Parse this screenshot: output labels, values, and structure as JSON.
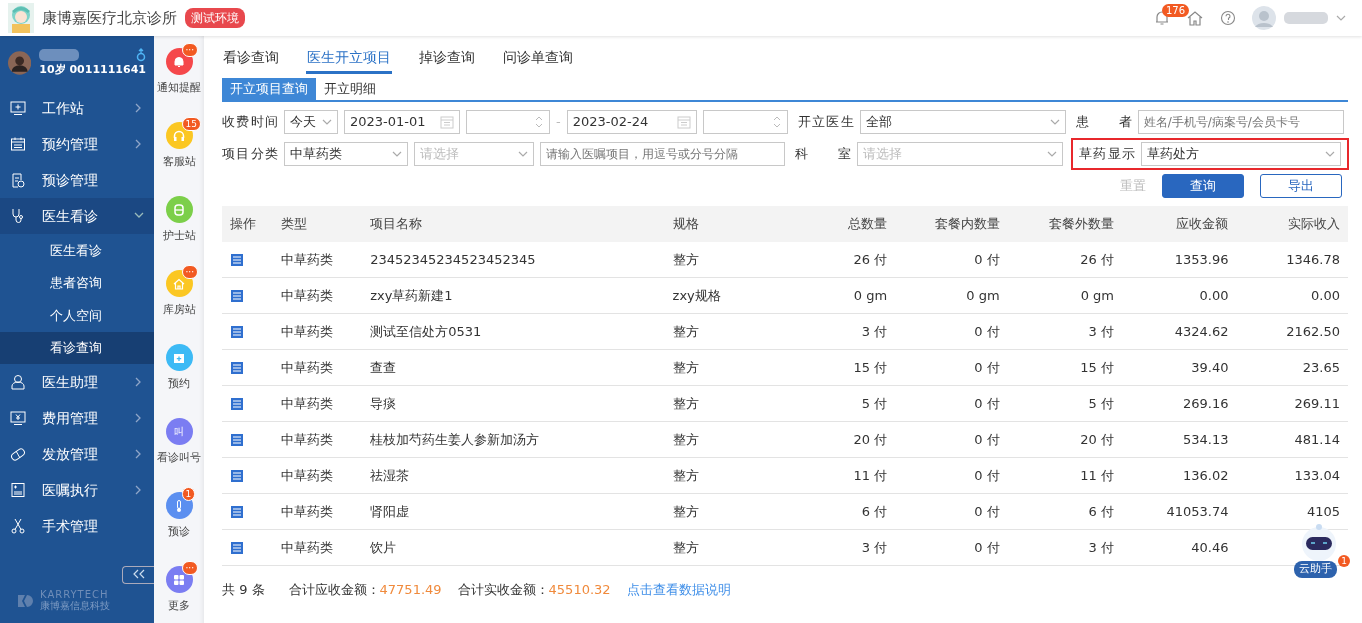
{
  "header": {
    "clinic_name": "康博嘉医疗北京诊所",
    "env_badge": "测试环境",
    "notification_count": "176"
  },
  "user": {
    "info": "10岁 0011111641"
  },
  "menu": [
    {
      "label": "工作站",
      "expandable": true,
      "expanded": false
    },
    {
      "label": "预约管理",
      "expandable": true,
      "expanded": false
    },
    {
      "label": "预诊管理",
      "expandable": false,
      "expanded": false
    },
    {
      "label": "医生看诊",
      "expandable": true,
      "expanded": true,
      "children": [
        {
          "label": "医生看诊",
          "selected": false
        },
        {
          "label": "患者咨询",
          "selected": false
        },
        {
          "label": "个人空间",
          "selected": false
        },
        {
          "label": "看诊查询",
          "selected": true
        }
      ]
    },
    {
      "label": "医生助理",
      "expandable": true,
      "expanded": false
    },
    {
      "label": "费用管理",
      "expandable": true,
      "expanded": false
    },
    {
      "label": "发放管理",
      "expandable": true,
      "expanded": false
    },
    {
      "label": "医嘱执行",
      "expandable": true,
      "expanded": false
    },
    {
      "label": "手术管理",
      "expandable": false,
      "expanded": false
    }
  ],
  "brand": "KARRYTECH",
  "brand_sub": "康博嘉信息科技",
  "quick_links": [
    {
      "label": "通知提醒",
      "color": "#f5484b",
      "badge": "···"
    },
    {
      "label": "客服站",
      "color": "#fbc723",
      "badge": "15"
    },
    {
      "label": "护士站",
      "color": "#7ccf4a"
    },
    {
      "label": "库房站",
      "color": "#fbc723",
      "badge": "···"
    },
    {
      "label": "预约",
      "color": "#3dbaf5"
    },
    {
      "label": "看诊叫号",
      "color": "#7b7df2",
      "glyph": "叫"
    },
    {
      "label": "预诊",
      "color": "#5b8ff0",
      "badge": "1"
    },
    {
      "label": "更多",
      "color": "#7b7df2",
      "badge": "···"
    }
  ],
  "tabs": [
    {
      "label": "看诊查询",
      "selected": false
    },
    {
      "label": "医生开立项目",
      "selected": true
    },
    {
      "label": "掉诊查询",
      "selected": false
    },
    {
      "label": "问诊单查询",
      "selected": false
    }
  ],
  "subtabs": [
    {
      "label": "开立项目查询",
      "selected": true
    },
    {
      "label": "开立明细",
      "selected": false
    }
  ],
  "filters": {
    "charge_time": {
      "label": "收费时间",
      "range": "今天",
      "start_date": "2023-01-01",
      "separator": "-",
      "end_date": "2023-02-24"
    },
    "doctor": {
      "label": "开立医生",
      "value": "全部"
    },
    "patient": {
      "label": "患者",
      "placeholder": "姓名/手机号/病案号/会员卡号"
    },
    "category": {
      "label": "项目分类",
      "value": "中草药类",
      "sub_placeholder": "请选择",
      "items_placeholder": "请输入医嘱项目，用逗号或分号分隔"
    },
    "department": {
      "label": "科室",
      "placeholder": "请选择"
    },
    "herb_display": {
      "label": "草药显示",
      "value": "草药处方",
      "highlighted": true
    }
  },
  "buttons": [
    {
      "label": "重置",
      "kind": "disabled"
    },
    {
      "label": "查询",
      "kind": "primary"
    },
    {
      "label": "导出",
      "kind": "outline"
    }
  ],
  "table": {
    "columns": [
      "操作",
      "类型",
      "项目名称",
      "规格",
      "总数量",
      "套餐内数量",
      "套餐外数量",
      "应收金额",
      "实际收入"
    ],
    "rows": [
      {
        "type": "中草药类",
        "name": "23452345234523452345",
        "spec": "整方",
        "total": "26 付",
        "in_package": "0 付",
        "out_package": "26 付",
        "receivable": "1353.96",
        "received": "1346.78"
      },
      {
        "type": "中草药类",
        "name": "zxy草药新建1",
        "spec": "zxy规格",
        "total": "0 gm",
        "in_package": "0 gm",
        "out_package": "0 gm",
        "receivable": "0.00",
        "received": "0.00"
      },
      {
        "type": "中草药类",
        "name": "测试至信处方0531",
        "spec": "整方",
        "total": "3 付",
        "in_package": "0 付",
        "out_package": "3 付",
        "receivable": "4324.62",
        "received": "2162.50"
      },
      {
        "type": "中草药类",
        "name": "查查",
        "spec": "整方",
        "total": "15 付",
        "in_package": "0 付",
        "out_package": "15 付",
        "receivable": "39.40",
        "received": "23.65"
      },
      {
        "type": "中草药类",
        "name": "导痰",
        "spec": "整方",
        "total": "5 付",
        "in_package": "0 付",
        "out_package": "5 付",
        "receivable": "269.16",
        "received": "269.11"
      },
      {
        "type": "中草药类",
        "name": "桂枝加芍药生姜人参新加汤方",
        "spec": "整方",
        "total": "20 付",
        "in_package": "0 付",
        "out_package": "20 付",
        "receivable": "534.13",
        "received": "481.14"
      },
      {
        "type": "中草药类",
        "name": "祛湿茶",
        "spec": "整方",
        "total": "11 付",
        "in_package": "0 付",
        "out_package": "11 付",
        "receivable": "136.02",
        "received": "133.04"
      },
      {
        "type": "中草药类",
        "name": "肾阳虚",
        "spec": "整方",
        "total": "6 付",
        "in_package": "0 付",
        "out_package": "6 付",
        "receivable": "41053.74",
        "received": "4105"
      },
      {
        "type": "中草药类",
        "name": "饮片",
        "spec": "整方",
        "total": "3 付",
        "in_package": "0 付",
        "out_package": "3 付",
        "receivable": "40.46"
      }
    ]
  },
  "footer": {
    "count": "共 9 条",
    "receivable_label": "合计应收金额：",
    "receivable_total": "47751.49",
    "received_label": "合计实收金额：",
    "received_total": "45510.32",
    "help_link": "点击查看数据说明"
  },
  "assistant": {
    "label": "云助手",
    "badge": "1"
  }
}
